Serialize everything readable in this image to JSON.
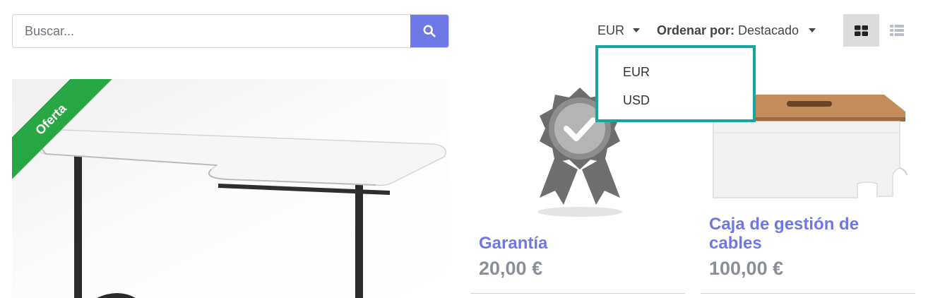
{
  "search": {
    "placeholder": "Buscar...",
    "icon": "search-icon"
  },
  "toolbar": {
    "pricelist_label": "EUR",
    "sort_label": "Ordenar por:",
    "sort_value": "Destacado",
    "grid_icon": "grid-view-icon",
    "list_icon": "list-view-icon"
  },
  "pricelist_dropdown": {
    "options": [
      "EUR",
      "USD"
    ]
  },
  "products": [
    {
      "ribbon": "Oferta"
    },
    {
      "name": "Garantía",
      "price": "20,00 €"
    },
    {
      "name": "Caja de gestión de cables",
      "price": "100,00 €"
    }
  ],
  "colors": {
    "accent": "#6e78e4",
    "ribbon": "#28a745",
    "highlight": "#17a69f",
    "price": "#8a8f97"
  }
}
